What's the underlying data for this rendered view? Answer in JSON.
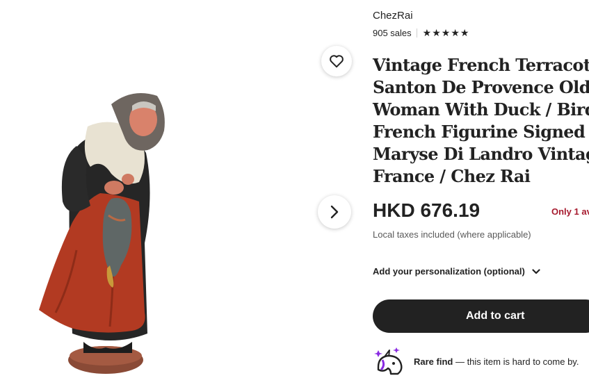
{
  "shop": {
    "name": "ChezRai",
    "sales": "905 sales",
    "rating_stars": 5
  },
  "listing": {
    "title_lines": [
      "Vintage French Terracotta",
      "Santon De Provence Old",
      "Woman With Duck / Bird",
      "French Figurine Signed By",
      "Maryse Di Landro Vintage",
      "France / Chez Rai"
    ],
    "price": "HKD 676.19",
    "stock_note": "Only 1 av",
    "taxes_note": "Local taxes included (where applicable)"
  },
  "personalization": {
    "label": "Add your personalization (optional)"
  },
  "cart": {
    "button_label": "Add to cart"
  },
  "rare_find": {
    "title": "Rare find",
    "description": " — this item is hard to come by."
  },
  "icons": {
    "favorite": "heart-icon",
    "next": "chevron-right-icon",
    "star": "star-icon",
    "dropdown": "chevron-down-icon",
    "rare": "unicorn-icon"
  },
  "colors": {
    "text": "#222222",
    "muted": "#595959",
    "stock_warning": "#a61a2e",
    "cart_button": "#222222",
    "sparkle": "#8a2be2"
  }
}
